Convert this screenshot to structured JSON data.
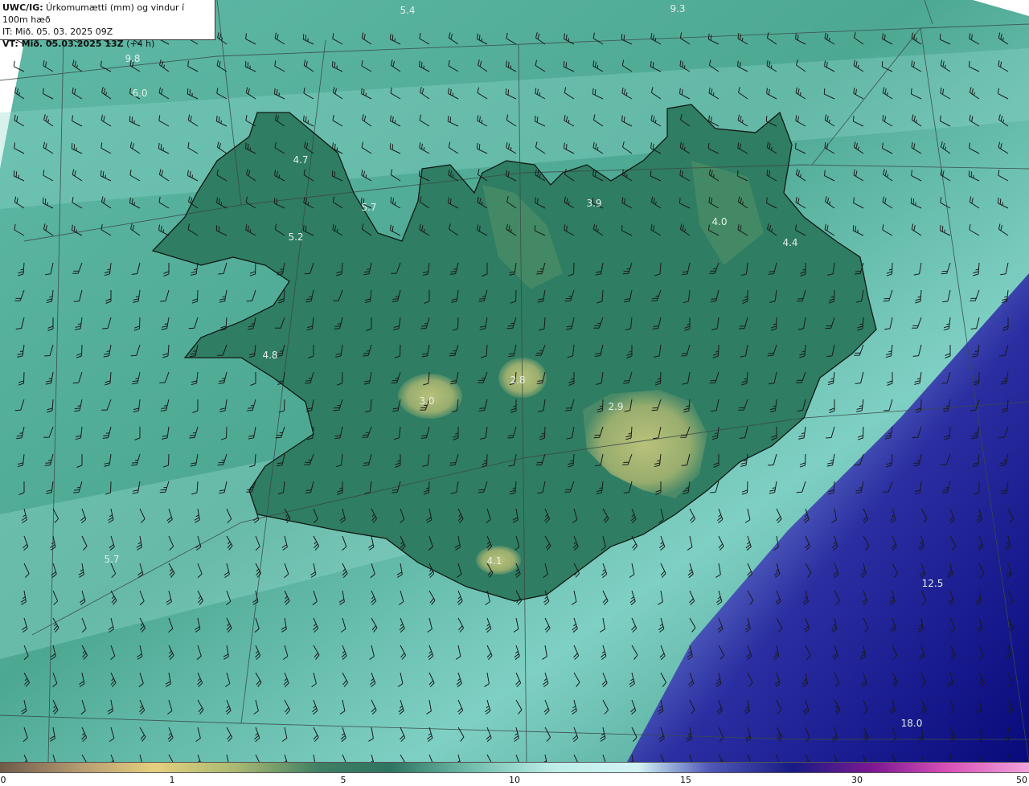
{
  "header": {
    "line1_bold": "UWC/IG:",
    "line1_rest": " Úrkomumætti (mm) og vindur í 100m hæð",
    "line2": "IT: Mið. 05. 03. 2025 09Z",
    "line3_bold": "VT: Mið. 05.03.2025 13Z",
    "line3_rest": " (+4 h)"
  },
  "map_labels": [
    "5.4",
    "9.3",
    "9.8",
    "6.0",
    "4.7",
    "5.7",
    "5.2",
    "3.9",
    "4.0",
    "4.4",
    "4.8",
    "2.8",
    "3.0",
    "2.9",
    "5.7",
    "4.1",
    "12.5",
    "18.0"
  ],
  "colorbar": {
    "ticks": [
      "0",
      "1",
      "5",
      "10",
      "15",
      "30",
      "50"
    ],
    "colors": [
      "#6f5a4a",
      "#b79d72",
      "#e4cf7e",
      "#a9b873",
      "#3f7f64",
      "#2f7461",
      "#73bfae",
      "#bfeee8",
      "#d2f3f4",
      "#4f57b8",
      "#161b85",
      "#7f1893",
      "#d84fb7",
      "#f1a3dc"
    ]
  },
  "palette": {
    "deep_sea": "#0d0e84",
    "mid_sea": "#69c6b5",
    "land": "#2f7d62",
    "highland": "#a7b670",
    "ice_light": "#c7f3ef"
  }
}
